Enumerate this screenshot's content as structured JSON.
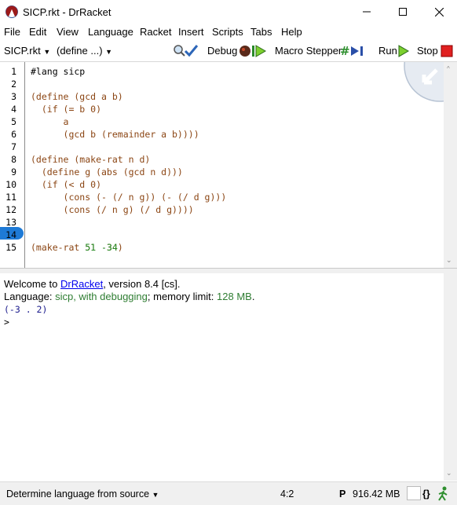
{
  "window": {
    "title": "SICP.rkt - DrRacket"
  },
  "menu": [
    "File",
    "Edit",
    "View",
    "Language",
    "Racket",
    "Insert",
    "Scripts",
    "Tabs",
    "Help"
  ],
  "toolbar": {
    "file_dropdown": "SICP.rkt",
    "define_dropdown": "(define ...)",
    "debug": "Debug",
    "macro_stepper": "Macro Stepper",
    "run": "Run",
    "stop": "Stop"
  },
  "editor": {
    "line_numbers": [
      "1",
      "2",
      "3",
      "4",
      "5",
      "6",
      "7",
      "8",
      "9",
      "10",
      "11",
      "12",
      "13",
      "14",
      "15"
    ],
    "current_line": "14",
    "lines": [
      "#lang sicp",
      "",
      "(define (gcd a b)",
      "  (if (= b 0)",
      "      a",
      "      (gcd b (remainder a b))))",
      "",
      "(define (make-rat n d)",
      "  (define g (abs (gcd n d)))",
      "  (if (< d 0)",
      "      (cons (- (/ n g)) (- (/ d g)))",
      "      (cons (/ n g) (/ d g))))",
      "",
      "",
      "(make-rat 51 -34)"
    ]
  },
  "repl": {
    "welcome_prefix": "Welcome to ",
    "welcome_link": "DrRacket",
    "welcome_suffix": ", version 8.4 [cs].",
    "language_label": "Language: ",
    "language_value": "sicp, with debugging",
    "memory_label": "; memory limit: ",
    "memory_value": "128 MB",
    "memory_end": ".",
    "result": "(-3 . 2)",
    "prompt": ">"
  },
  "status": {
    "language_selector": "Determine language from source",
    "position": "4:2",
    "p_label": "P",
    "memory": "916.42 MB",
    "braces": "{}"
  },
  "colors": {
    "paren": "#8b4513",
    "number": "#228b22",
    "link": "#0000ee",
    "current_line": "#1e7ad6",
    "repl_green": "#2e7d32"
  }
}
